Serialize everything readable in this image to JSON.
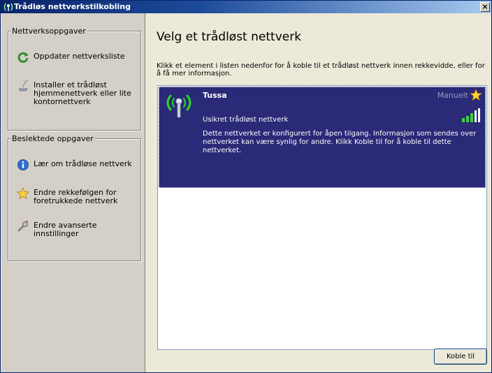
{
  "window": {
    "title": "Trådløs nettverkstilkobling",
    "close_label": "×"
  },
  "left": {
    "network_tasks": {
      "legend": "Nettverksoppgaver",
      "items": [
        {
          "label": "Oppdater nettverksliste",
          "icon": "refresh-icon"
        },
        {
          "label": "Installer et trådløst\nhjemmenettverk eller lite\nkontornettverk",
          "icon": "wireless-setup-icon"
        }
      ]
    },
    "related_tasks": {
      "legend": "Beslektede oppgaver",
      "items": [
        {
          "label": "Lær om trådløse nettverk",
          "icon": "info-icon"
        },
        {
          "label": "Endre rekkefølgen for\nforetrukkede nettverk",
          "icon": "star-icon"
        },
        {
          "label": "Endre avanserte\ninnstillinger",
          "icon": "wrench-icon"
        }
      ]
    }
  },
  "main": {
    "heading": "Velg et trådløst nettverk",
    "instructions": "Klikk et element i listen nedenfor for å koble til et trådløst nettverk innen rekkevidde, eller for å få mer informasjon.",
    "networks": [
      {
        "name": "Tussa",
        "mode": "Manuelt",
        "security": "Usikret trådløst nettverk",
        "signal_bars": 5,
        "description": "Dette nettverket er konfigurert for åpen tilgang. Informasjon som sendes over nettverket kan være synlig for andre. Klikk Koble til for å koble til dette nettverket."
      }
    ],
    "connect_label": "Koble til"
  },
  "colors": {
    "titlebar_start": "#0a246a",
    "titlebar_end": "#a6caf0",
    "selected_item": "#2a2a78",
    "pane_background": "#d4d0c8"
  }
}
